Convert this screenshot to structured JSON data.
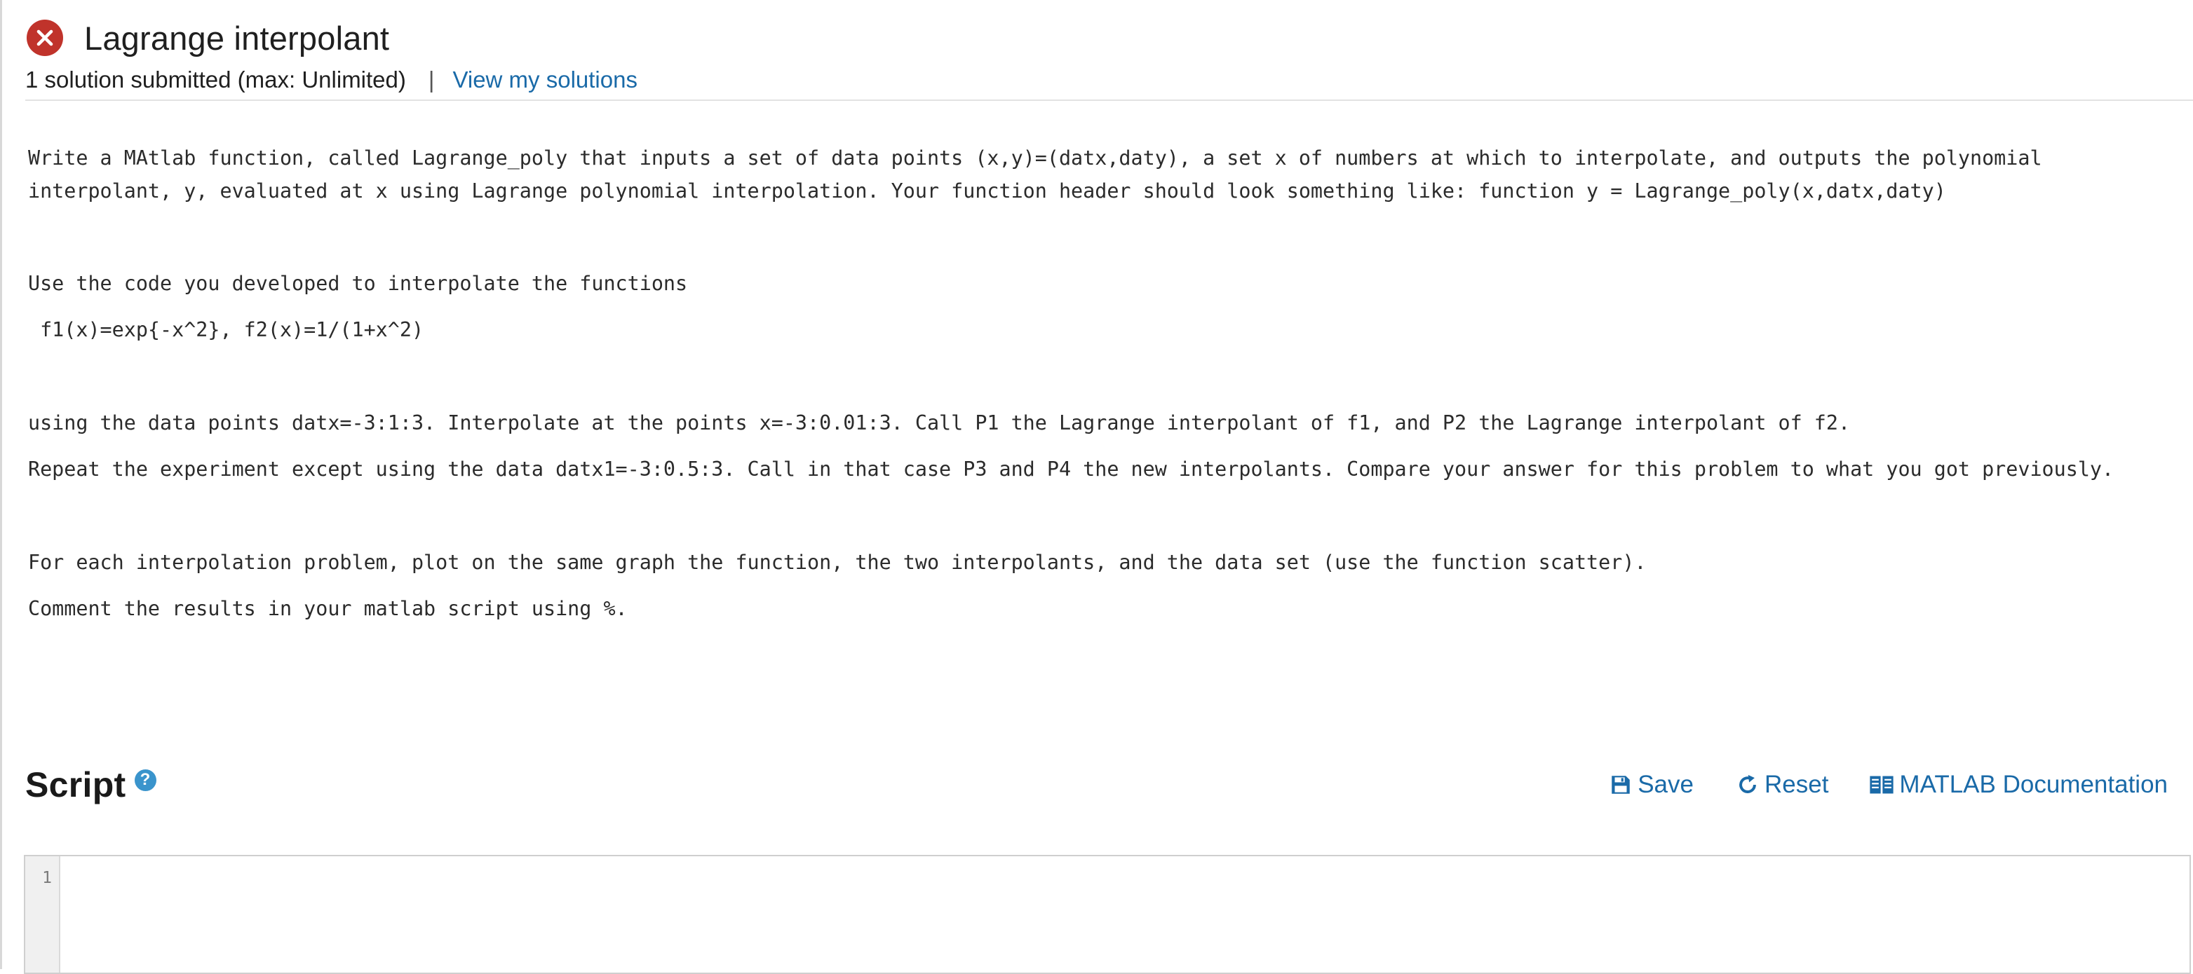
{
  "header": {
    "title": "Lagrange interpolant",
    "status_icon": "error-x-icon",
    "status_color": "#c0332b",
    "submitted": "1 solution submitted (max: Unlimited)",
    "separator": "|",
    "view_solutions": "View my solutions"
  },
  "description": {
    "paragraphs": [
      "Write a MAtlab function, called Lagrange_poly that inputs a set of data points (x,y)=(datx,daty), a set x of numbers at which to interpolate, and outputs the polynomial",
      "interpolant, y, evaluated at x using Lagrange polynomial interpolation. Your function header should look something like: function y = Lagrange_poly(x,datx,daty)",
      "Use the code you developed to interpolate the functions",
      " f1(x)=exp{-x^2}, f2(x)=1/(1+x^2)",
      "using the data points datx=-3:1:3. Interpolate at the points x=-3:0.01:3. Call P1 the Lagrange interpolant of f1, and P2 the Lagrange interpolant of f2.",
      "Repeat the experiment except using the data datx1=-3:0.5:3. Call in that case P3 and P4 the new interpolants. Compare your answer for this problem to what you got previously.",
      "For each interpolation problem, plot on the same graph the function, the two interpolants, and the data set (use the function scatter).",
      "Comment the results in your matlab script using %."
    ]
  },
  "script": {
    "heading": "Script",
    "help_icon": "question-circle-icon",
    "help_glyph": "?",
    "toolbar": {
      "save_label": "Save",
      "reset_label": "Reset",
      "docs_label": "MATLAB Documentation"
    },
    "editor": {
      "line_numbers": [
        "1"
      ],
      "content": ""
    }
  },
  "colors": {
    "link": "#1a6aa8",
    "help_icon": "#3a94cc",
    "error": "#c0332b"
  }
}
